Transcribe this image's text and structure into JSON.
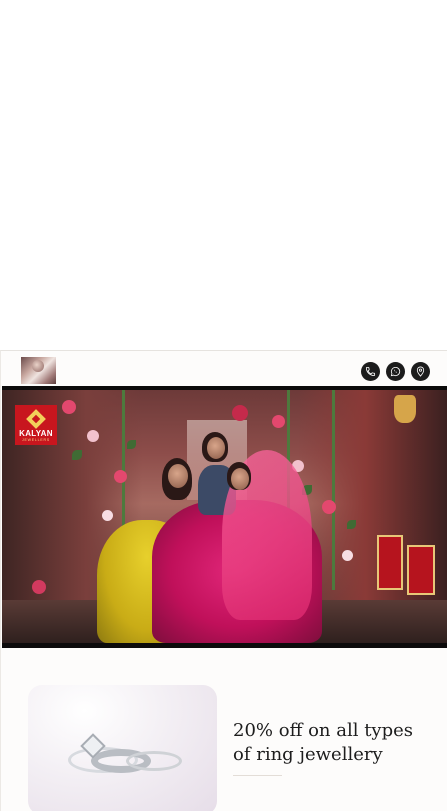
{
  "header": {
    "thumbnail": "jewellery-thumbnail",
    "actions": [
      {
        "name": "phone-icon"
      },
      {
        "name": "whatsapp-icon"
      },
      {
        "name": "location-pin-icon"
      }
    ]
  },
  "video": {
    "brand_logo": {
      "name": "KALYAN",
      "subtitle": "JEWELLERS"
    }
  },
  "promo": {
    "headline": "20% off on all types of ring jewellery"
  },
  "colors": {
    "icon_bg": "#1c1c1c",
    "logo_red": "#c8161e",
    "logo_gold": "#f3cf5a",
    "text_dark": "#1d1d1d"
  }
}
